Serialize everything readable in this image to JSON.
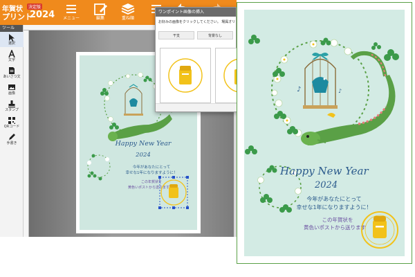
{
  "app": {
    "logo": {
      "line1": "年賀状",
      "line2": "プリント",
      "badge": "決定版",
      "year": "2024"
    },
    "toolbar": [
      {
        "name": "menu",
        "label": "メニュー",
        "icon": "menu-icon"
      },
      {
        "name": "edit",
        "label": "編集",
        "icon": "edit-icon"
      },
      {
        "name": "layer",
        "label": "重ね順",
        "icon": "layers-icon"
      },
      {
        "name": "align",
        "label": "",
        "icon": "align-icon"
      },
      {
        "name": "undo",
        "label": "",
        "icon": "undo-icon"
      }
    ],
    "tools_header": "ツール",
    "tools": [
      {
        "label": "選択",
        "icon": "cursor-icon"
      },
      {
        "label": "文字",
        "icon": "text-icon"
      },
      {
        "label": "あいさつ文",
        "icon": "document-icon"
      },
      {
        "label": "画像",
        "icon": "image-icon"
      },
      {
        "label": "スタンプ",
        "icon": "stamp-icon"
      },
      {
        "label": "QRコード",
        "icon": "qr-icon"
      },
      {
        "label": "手書き",
        "icon": "pen-icon"
      }
    ]
  },
  "dialog": {
    "title": "ワンポイント画像の挿入",
    "description": "お好みの画像をクリックしてください。 場属オリ",
    "tabs": [
      "干支",
      "背景なし"
    ]
  },
  "card": {
    "title": "Happy New Year",
    "year": "2024",
    "message_line1": "今年があなたにとって",
    "message_line2": "幸せな1年になりますように！",
    "sub_line1": "この年賀状を",
    "sub_line2": "黄色いポストから送ります",
    "stamp_text": "この年賀状を黄色いポストから",
    "colors": {
      "background": "#d3ebe4",
      "accent": "#f08a1c",
      "text_blue": "#2b5a8c",
      "text_purple": "#6a4fa0",
      "dragon_green": "#5aa046",
      "post_yellow": "#f2c21a"
    }
  }
}
